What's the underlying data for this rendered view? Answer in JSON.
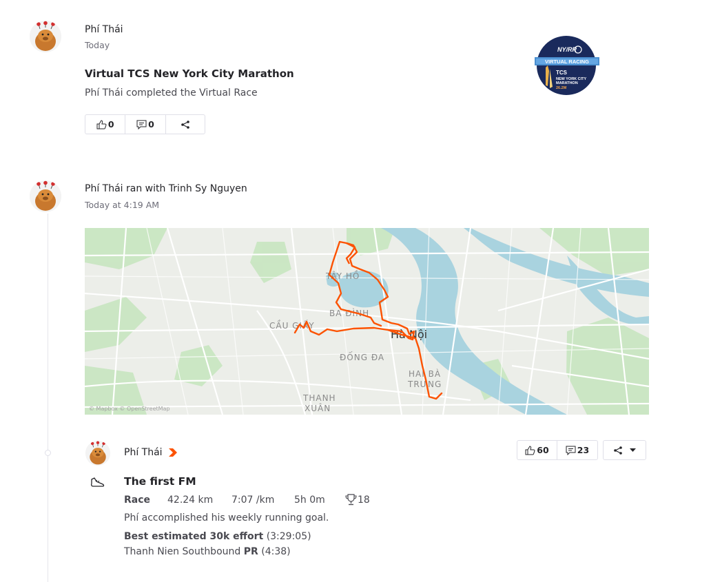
{
  "post1": {
    "author": "Phí Thái",
    "time": "Today",
    "title": "Virtual TCS New York City Marathon",
    "description": "Phí Thái completed the Virtual Race",
    "kudos_count": "0",
    "comments_count": "0",
    "badge": {
      "top": "NY/RR",
      "band": "VIRTUAL RACING",
      "line1": "TCS",
      "line2": "NEW YORK CITY",
      "line3": "MARATHON",
      "line4": "26.2M"
    }
  },
  "post2": {
    "header": "Phí Thái ran with Trinh Sy Nguyen",
    "time": "Today at 4:19 AM",
    "map": {
      "labels": {
        "tay_ho": "TÂY HỒ",
        "ba_dinh": "BA ĐÌNH",
        "cau_giay": "CẦU GIẤY",
        "ha_noi": "Hà Nội",
        "dong_da": "ĐỐNG ĐA",
        "hai_ba": "HAI BÀ",
        "trung": "TRƯNG",
        "thanh": "THANH",
        "xuan": "XUÂN"
      },
      "attribution": "© Mapbox © OpenStreetMap"
    },
    "activity": {
      "athlete": "Phí Thái",
      "name": "The first FM",
      "type_label": "Race",
      "distance": "42.24 km",
      "pace": "7:07 /km",
      "time": "5h 0m",
      "achievements": "18",
      "goal_text": "Phí accomplished his weekly running goal.",
      "effort_label": "Best estimated 30k effort",
      "effort_value": "(3:29:05)",
      "segment_name": "Thanh Nien Southbound",
      "segment_pr": "PR",
      "segment_value": "(4:38)",
      "kudos_count": "60",
      "comments_count": "23"
    }
  },
  "colors": {
    "route": "#fc5200",
    "water": "#a9d3df",
    "park": "#c8e6c0",
    "land": "#eceee9"
  }
}
